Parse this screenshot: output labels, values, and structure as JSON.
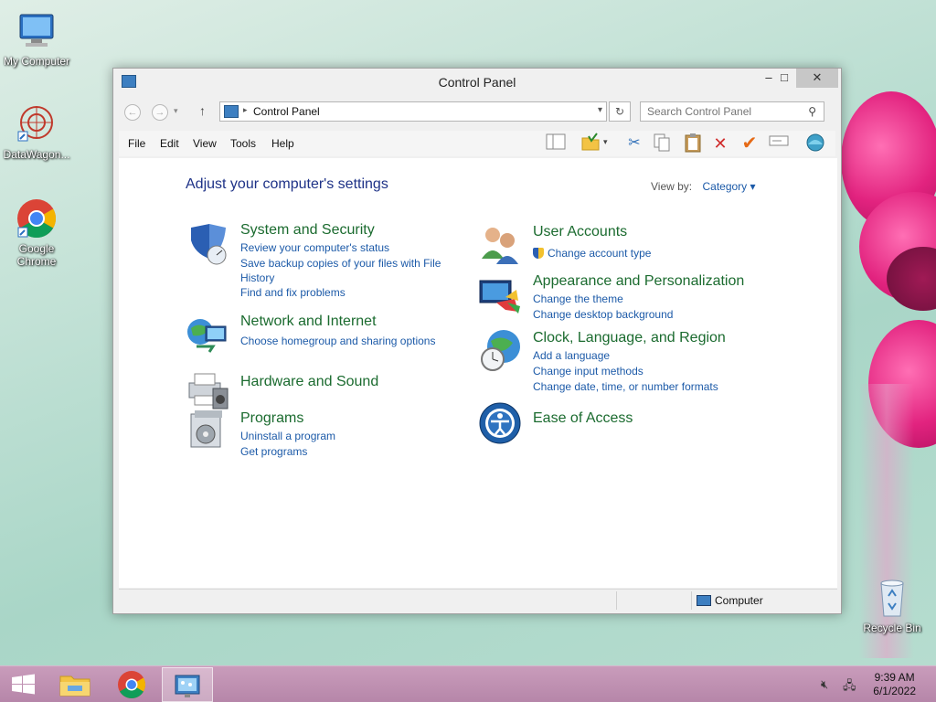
{
  "desktop": {
    "icons": [
      {
        "label": "My Computer",
        "icon": "my-computer-icon"
      },
      {
        "label": "DataWagon...",
        "icon": "datawagon-icon"
      },
      {
        "label": "Google Chrome",
        "icon": "chrome-icon"
      },
      {
        "label": "Recycle Bin",
        "icon": "recycle-bin-icon"
      }
    ]
  },
  "window": {
    "title": "Control Panel",
    "controls": {
      "minimize": "–",
      "maximize": "□",
      "close": "✕"
    },
    "address": {
      "crumb": "Control Panel"
    },
    "search": {
      "placeholder": "Search Control Panel"
    },
    "menu": [
      "File",
      "Edit",
      "View",
      "Tools",
      "Help"
    ],
    "heading": "Adjust your computer's settings",
    "view_by": {
      "label": "View by:",
      "value": "Category"
    },
    "categories_left": [
      {
        "title": "System and Security",
        "icon": "shield-icon",
        "links": [
          "Review your computer's status",
          "Save backup copies of your files with File",
          "History",
          "Find and fix problems"
        ]
      },
      {
        "title": "Network and Internet",
        "icon": "network-icon",
        "links": [
          "Choose homegroup and sharing options"
        ]
      },
      {
        "title": "Hardware and Sound",
        "icon": "printer-icon",
        "links": []
      },
      {
        "title": "Programs",
        "icon": "programs-icon",
        "links": [
          "Uninstall a program",
          "Get programs"
        ]
      }
    ],
    "categories_right": [
      {
        "title": "User Accounts",
        "icon": "users-icon",
        "links": [
          "Change account type"
        ]
      },
      {
        "title": "Appearance and Personalization",
        "icon": "monitor-icon",
        "links": [
          "Change the theme",
          "Change desktop background"
        ]
      },
      {
        "title": "Clock, Language, and Region",
        "icon": "globe-clock-icon",
        "links": [
          "Add a language",
          "Change input methods",
          "Change date, time, or number formats"
        ]
      },
      {
        "title": "Ease of Access",
        "icon": "ease-of-access-icon",
        "links": []
      }
    ],
    "status": {
      "location": "Computer"
    }
  },
  "taskbar": {
    "time": "9:39 AM",
    "date": "6/1/2022"
  },
  "colors": {
    "link": "#1c5aa8",
    "category_title": "#1b6b2f",
    "heading": "#1e3287",
    "taskbar": "#c49ab7"
  }
}
